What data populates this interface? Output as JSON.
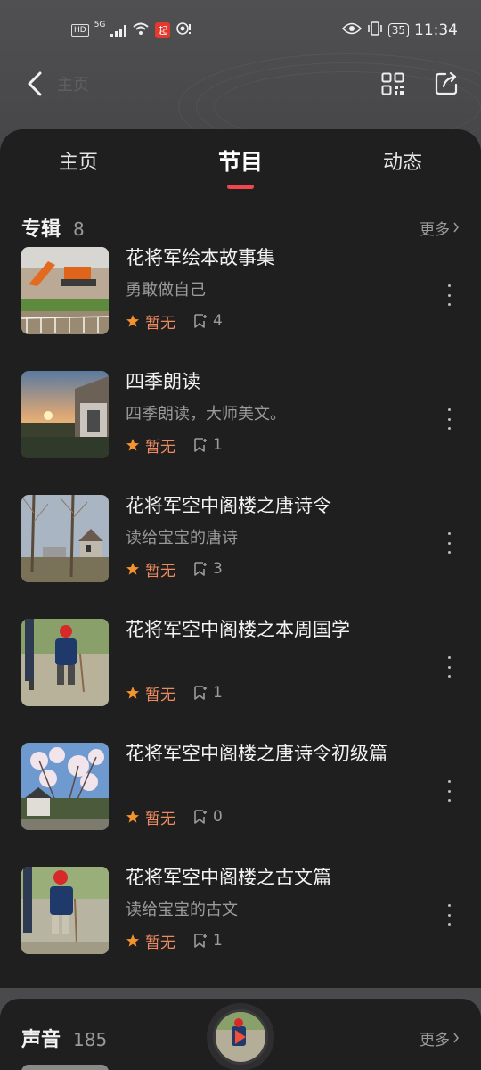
{
  "status_bar": {
    "network_badge": "HD",
    "network_type": "5G",
    "app_badge": "起",
    "battery": "35",
    "time": "11:34"
  },
  "nav": {
    "title": "主页"
  },
  "tabs": [
    {
      "label": "主页",
      "active": false
    },
    {
      "label": "节目",
      "active": true
    },
    {
      "label": "动态",
      "active": false
    }
  ],
  "albums_section": {
    "title": "专辑",
    "count": "8",
    "more": "更多"
  },
  "albums": [
    {
      "title": "花将军绘本故事集",
      "desc": "勇敢做自己",
      "score": "暂无",
      "tracks": "4"
    },
    {
      "title": "四季朗读",
      "desc": "四季朗读，大师美文。",
      "score": "暂无",
      "tracks": "1"
    },
    {
      "title": "花将军空中阁楼之唐诗令",
      "desc": "读给宝宝的唐诗",
      "score": "暂无",
      "tracks": "3"
    },
    {
      "title": "花将军空中阁楼之本周国学",
      "desc": "",
      "score": "暂无",
      "tracks": "1"
    },
    {
      "title": "花将军空中阁楼之唐诗令初级篇",
      "desc": "",
      "score": "暂无",
      "tracks": "0"
    },
    {
      "title": "花将军空中阁楼之古文篇",
      "desc": "读给宝宝的古文",
      "score": "暂无",
      "tracks": "1"
    }
  ],
  "sounds_section": {
    "title": "声音",
    "count": "185",
    "more": "更多"
  },
  "colors": {
    "accent": "#f0474e",
    "score": "#ee8a5f",
    "sheet": "#1f1f20"
  }
}
